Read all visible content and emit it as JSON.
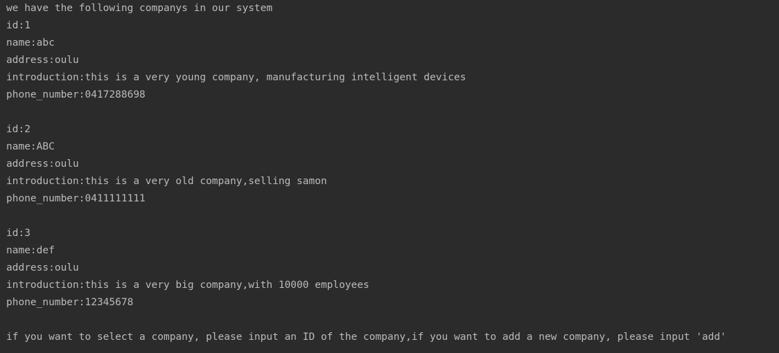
{
  "console": {
    "header": "we have the following companys in our system",
    "companies": [
      {
        "id": "id:1",
        "name": "name:abc",
        "address": "address:oulu",
        "introduction": "introduction:this is a very young company, manufacturing intelligent devices",
        "phone": "phone_number:0417288698"
      },
      {
        "id": "id:2",
        "name": "name:ABC",
        "address": "address:oulu",
        "introduction": "introduction:this is a very old company,selling samon",
        "phone": "phone_number:0411111111"
      },
      {
        "id": "id:3",
        "name": "name:def",
        "address": "address:oulu",
        "introduction": "introduction:this is a very big company,with 10000 employees",
        "phone": "phone_number:12345678"
      }
    ],
    "prompt": "if you want to select a company, please input an ID of the company,if you want to add a new company, please input 'add'"
  },
  "colors": {
    "background": "#2b2b2b",
    "text": "#bbbbbb"
  }
}
